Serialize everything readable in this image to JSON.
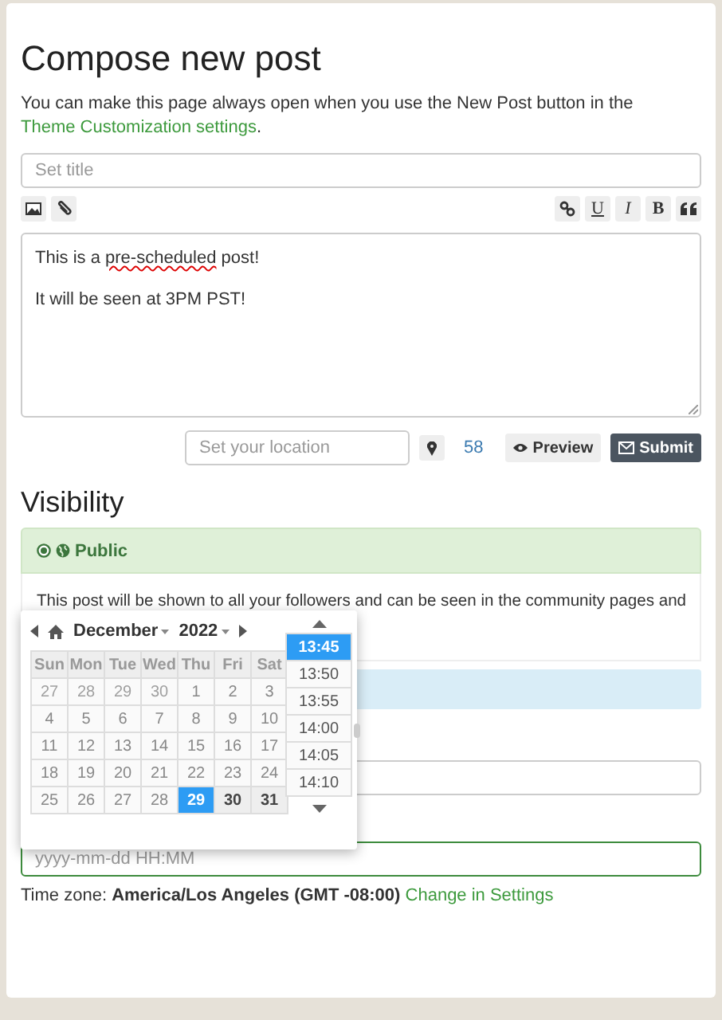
{
  "heading": "Compose new post",
  "intro": {
    "text": "You can make this page always open when you use the New Post button in the ",
    "link": "Theme Customization settings",
    "end": "."
  },
  "title_field": {
    "placeholder": "Set title"
  },
  "toolbar": {
    "left": [
      {
        "kind": "image"
      },
      {
        "kind": "attach"
      }
    ],
    "right": [
      {
        "kind": "link"
      },
      {
        "kind": "underline",
        "label": "U"
      },
      {
        "kind": "italic",
        "label": "I"
      },
      {
        "kind": "bold",
        "label": "B"
      },
      {
        "kind": "quote"
      }
    ]
  },
  "body": [
    {
      "segments": [
        {
          "text": "This is a "
        },
        {
          "text": "pre-scheduled",
          "misspelled": true
        },
        {
          "text": " post!"
        }
      ]
    },
    {
      "segments": [
        {
          "text": "It will be seen at 3PM PST!"
        }
      ]
    }
  ],
  "location": {
    "placeholder": "Set your location"
  },
  "char_count": "58",
  "buttons": [
    {
      "kind": "preview",
      "label": "Preview"
    },
    {
      "kind": "submit",
      "label": "Submit"
    }
  ],
  "visibility": {
    "heading": "Visibility",
    "option": {
      "label": "Public",
      "selected": true,
      "description": "This post will be shown to all your followers and can be seen in the community pages and"
    }
  },
  "schedule": {
    "placeholder": "yyyy-mm-dd HH:MM",
    "timezone": "Time zone: **America/Los Angeles (GMT -08:00)** ",
    "settings_link": "Change in Settings"
  },
  "datepicker": {
    "month": "December",
    "year": "2022",
    "weekdays": [
      "Sun",
      "Mon",
      "Tue",
      "Wed",
      "Thu",
      "Fri",
      "Sat"
    ],
    "days": [
      {
        "label": "27",
        "outside": true,
        "disabled": true,
        "selected": false
      },
      {
        "label": "28",
        "outside": true,
        "disabled": true,
        "selected": false
      },
      {
        "label": "29",
        "outside": true,
        "disabled": true,
        "selected": false
      },
      {
        "label": "30",
        "outside": true,
        "disabled": true,
        "selected": false
      },
      {
        "label": "1",
        "outside": false,
        "disabled": true,
        "selected": false
      },
      {
        "label": "2",
        "outside": false,
        "disabled": true,
        "selected": false
      },
      {
        "label": "3",
        "outside": false,
        "disabled": true,
        "selected": false
      },
      {
        "label": "4",
        "outside": false,
        "disabled": true,
        "selected": false
      },
      {
        "label": "5",
        "outside": false,
        "disabled": true,
        "selected": false
      },
      {
        "label": "6",
        "outside": false,
        "disabled": true,
        "selected": false
      },
      {
        "label": "7",
        "outside": false,
        "disabled": true,
        "selected": false
      },
      {
        "label": "8",
        "outside": false,
        "disabled": true,
        "selected": false
      },
      {
        "label": "9",
        "outside": false,
        "disabled": true,
        "selected": false
      },
      {
        "label": "10",
        "outside": false,
        "disabled": true,
        "selected": false
      },
      {
        "label": "11",
        "outside": false,
        "disabled": true,
        "selected": false
      },
      {
        "label": "12",
        "outside": false,
        "disabled": true,
        "selected": false
      },
      {
        "label": "13",
        "outside": false,
        "disabled": true,
        "selected": false
      },
      {
        "label": "14",
        "outside": false,
        "disabled": true,
        "selected": false
      },
      {
        "label": "15",
        "outside": false,
        "disabled": true,
        "selected": false
      },
      {
        "label": "16",
        "outside": false,
        "disabled": true,
        "selected": false
      },
      {
        "label": "17",
        "outside": false,
        "disabled": true,
        "selected": false
      },
      {
        "label": "18",
        "outside": false,
        "disabled": true,
        "selected": false
      },
      {
        "label": "19",
        "outside": false,
        "disabled": true,
        "selected": false
      },
      {
        "label": "20",
        "outside": false,
        "disabled": true,
        "selected": false
      },
      {
        "label": "21",
        "outside": false,
        "disabled": true,
        "selected": false
      },
      {
        "label": "22",
        "outside": false,
        "disabled": true,
        "selected": false
      },
      {
        "label": "23",
        "outside": false,
        "disabled": true,
        "selected": false
      },
      {
        "label": "24",
        "outside": false,
        "disabled": true,
        "selected": false
      },
      {
        "label": "25",
        "outside": false,
        "disabled": true,
        "selected": false
      },
      {
        "label": "26",
        "outside": false,
        "disabled": true,
        "selected": false
      },
      {
        "label": "27",
        "outside": false,
        "disabled": true,
        "selected": false
      },
      {
        "label": "28",
        "outside": false,
        "disabled": true,
        "selected": false
      },
      {
        "label": "29",
        "outside": false,
        "disabled": false,
        "selected": true
      },
      {
        "label": "30",
        "outside": false,
        "disabled": false,
        "selected": false
      },
      {
        "label": "31",
        "outside": false,
        "disabled": false,
        "selected": false
      }
    ],
    "times": [
      {
        "label": "13:45",
        "selected": true
      },
      {
        "label": "13:50",
        "selected": false
      },
      {
        "label": "13:55",
        "selected": false
      },
      {
        "label": "14:00",
        "selected": false
      },
      {
        "label": "14:05",
        "selected": false
      },
      {
        "label": "14:10",
        "selected": false
      }
    ]
  }
}
